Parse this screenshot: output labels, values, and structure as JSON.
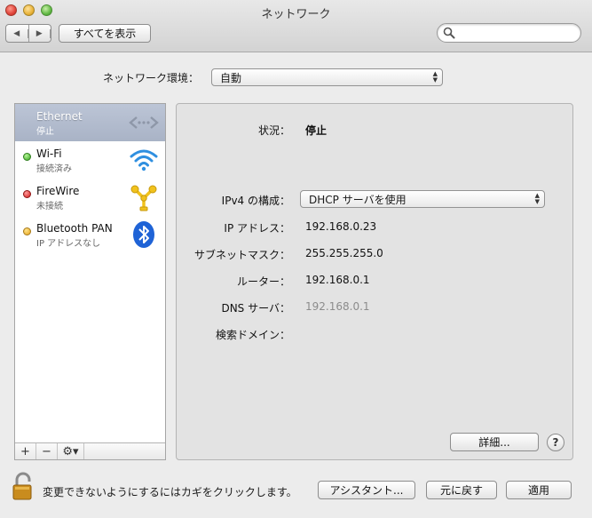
{
  "window": {
    "title": "ネットワーク"
  },
  "toolbar": {
    "show_all_label": "すべてを表示",
    "back_icon": "◀",
    "forward_icon": "▶"
  },
  "search": {
    "placeholder": ""
  },
  "location": {
    "label": "ネットワーク環境：",
    "value": "自動"
  },
  "services": [
    {
      "name": "Ethernet",
      "status": "停止",
      "indicator": "none",
      "selected": true,
      "icon": "ethernet-icon"
    },
    {
      "name": "Wi-Fi",
      "status": "接続済み",
      "indicator": "green",
      "selected": false,
      "icon": "wifi-icon"
    },
    {
      "name": "FireWire",
      "status": "未接続",
      "indicator": "red",
      "selected": false,
      "icon": "firewire-icon"
    },
    {
      "name": "Bluetooth PAN",
      "status": "IP アドレスなし",
      "indicator": "yellow",
      "selected": false,
      "icon": "bluetooth-icon"
    }
  ],
  "sidebar_actions": {
    "add": "+",
    "remove": "−",
    "gear": "⚙▾"
  },
  "detail": {
    "status_label": "状況：",
    "status_value": "停止",
    "ipv4_label": "IPv4 の構成：",
    "ipv4_value": "DHCP サーバを使用",
    "ip_label": "IP アドレス：",
    "ip_value": "192.168.0.23",
    "subnet_label": "サブネットマスク：",
    "subnet_value": "255.255.255.0",
    "router_label": "ルーター：",
    "router_value": "192.168.0.1",
    "dns_label": "DNS サーバ：",
    "dns_value": "192.168.0.1",
    "search_domain_label": "検索ドメイン：",
    "advanced_label": "詳細...",
    "help_label": "?"
  },
  "footer": {
    "lock_text": "変更できないようにするにはカギをクリックします。",
    "assistant_label": "アシスタント...",
    "revert_label": "元に戻す",
    "apply_label": "適用"
  },
  "colors": {
    "selection": "#aeb8cb",
    "wifi_blue": "#2f8fe0",
    "bluetooth_blue": "#1f63d6",
    "firewire_yellow": "#f1c21d"
  }
}
